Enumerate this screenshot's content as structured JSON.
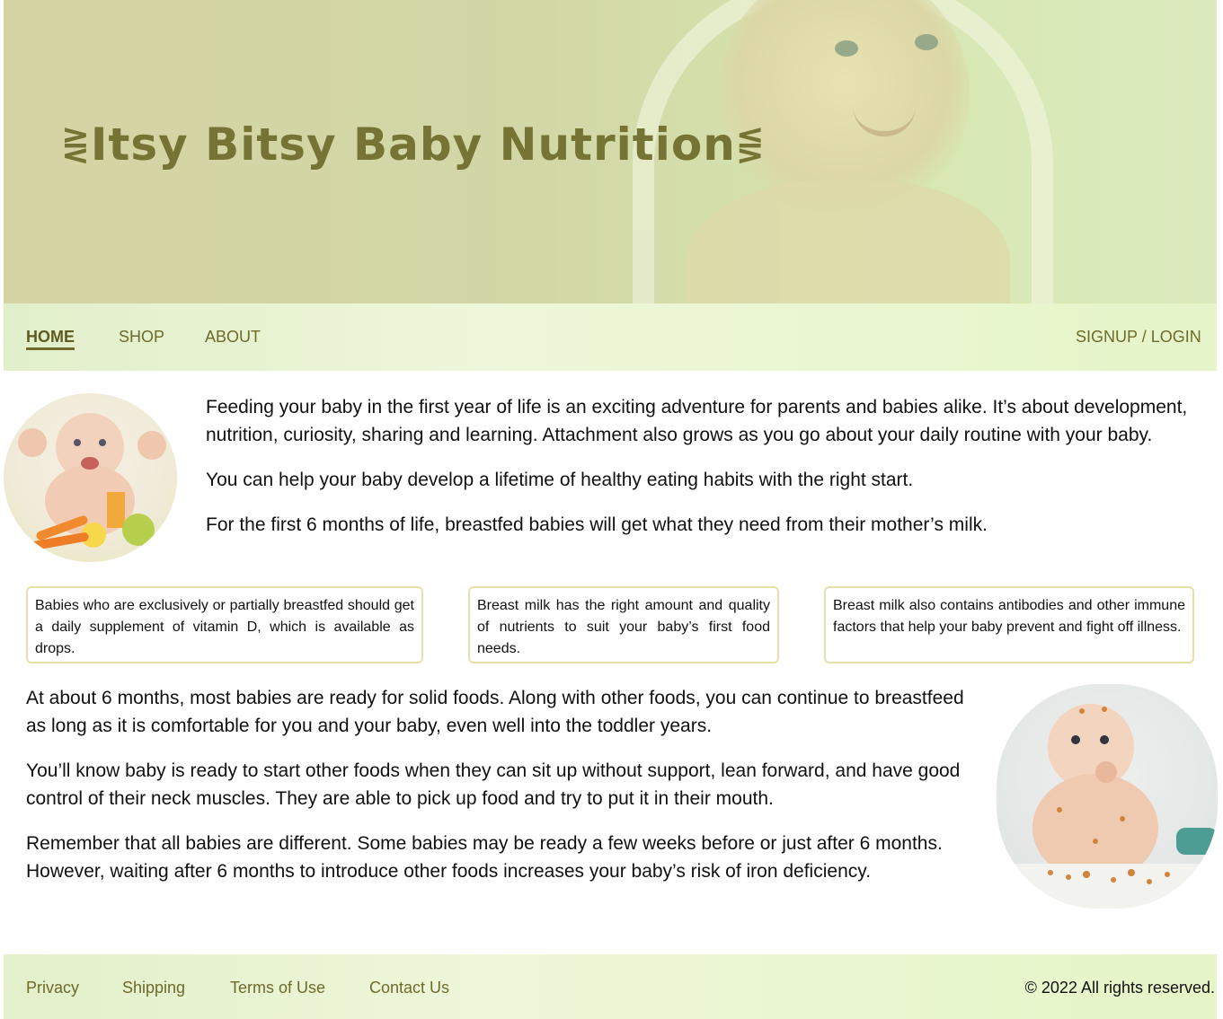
{
  "header": {
    "title": "Itsy Bitsy Baby Nutrition",
    "title_color": "#767434"
  },
  "nav": {
    "items": [
      {
        "label": "HOME",
        "active": true
      },
      {
        "label": "SHOP",
        "active": false
      },
      {
        "label": "ABOUT",
        "active": false
      }
    ],
    "account_label": "SIGNUP / LOGIN"
  },
  "intro": {
    "paragraphs": [
      "Feeding your baby in the first year of life is an exciting adventure for parents and babies alike. It’s about development, nutrition, curiosity, sharing and learning. Attachment also grows as you go about your daily routine with your baby.",
      "You can help your baby develop a lifetime of healthy eating habits with the right start.",
      "For the first 6 months of life, breastfed babies will get what they need from their mother’s milk."
    ]
  },
  "cards": [
    "Babies who are exclusively or partially breastfed should get a daily supplement of vitamin D, which is available as drops.",
    "Breast milk has the right amount and quality of nutrients to suit your baby’s first food needs.",
    "Breast milk also contains antibodies and other immune factors that help your baby prevent and fight off illness."
  ],
  "lower": {
    "paragraphs": [
      "At about 6 months, most babies are ready for solid foods. Along with other foods, you can continue to breastfeed as long as it is comfortable for you and your baby, even well into the toddler years.",
      "You’ll know baby is ready to start other foods when they can sit up without support, lean forward, and have good control of their neck muscles. They are able to pick up food and try to put it in their mouth.",
      "Remember that all babies are different. Some babies may be ready a few weeks before or just after 6 months. However, waiting after 6 months to introduce other foods increases your baby’s risk of iron deficiency."
    ]
  },
  "footer": {
    "links": [
      "Privacy",
      "Shipping",
      "Terms of Use",
      "Contact Us"
    ],
    "copyright": "© 2022 All rights reserved."
  },
  "colors": {
    "accent": "#6d6a2a",
    "nav_bg": "#e6f5c9",
    "card_border": "#e6e0a8"
  }
}
